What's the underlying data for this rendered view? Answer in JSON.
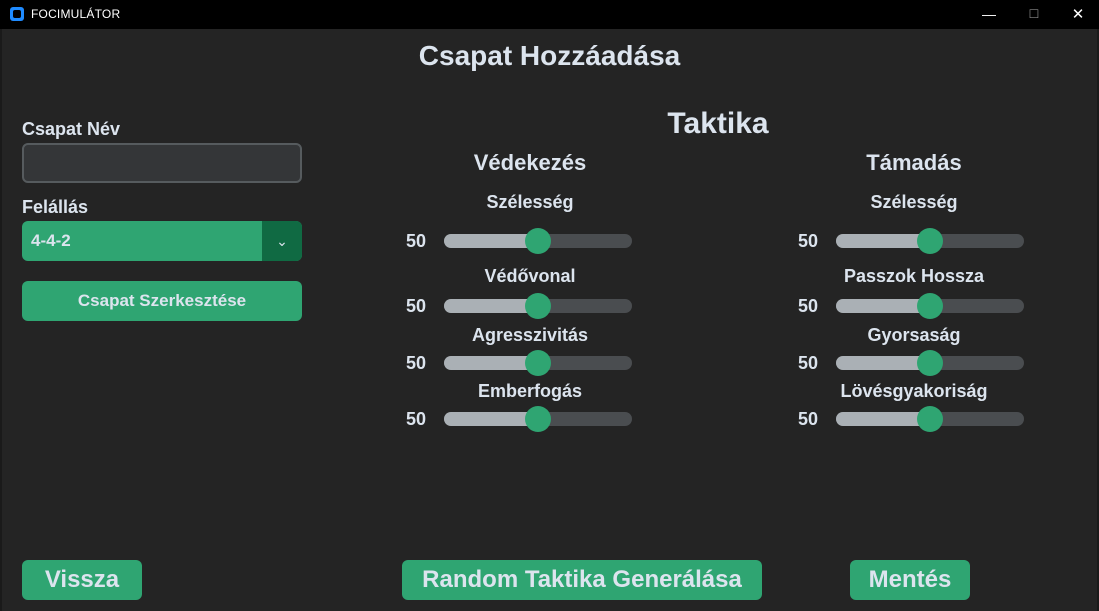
{
  "window": {
    "title": "FOCIMULÁTOR",
    "minimize_glyph": "—",
    "maximize_glyph": "☐",
    "close_glyph": "✕",
    "icon": "app-icon"
  },
  "page": {
    "title": "Csapat Hozzáadása"
  },
  "form": {
    "team_name_label": "Csapat Név",
    "team_name_value": "",
    "formation_label": "Felállás",
    "formation_value": "4-4-2",
    "formation_arrow": "⌄",
    "edit_team_label": "Csapat Szerkesztése"
  },
  "tactics": {
    "title": "Taktika",
    "defense": {
      "title": "Védekezés",
      "sliders": [
        {
          "label": "Szélesség",
          "value": "50",
          "fraction": 0.5
        },
        {
          "label": "Védővonal",
          "value": "50",
          "fraction": 0.5
        },
        {
          "label": "Agresszivitás",
          "value": "50",
          "fraction": 0.5
        },
        {
          "label": "Emberfogás",
          "value": "50",
          "fraction": 0.5
        }
      ]
    },
    "attack": {
      "title": "Támadás",
      "sliders": [
        {
          "label": "Szélesség",
          "value": "50",
          "fraction": 0.5
        },
        {
          "label": "Passzok Hossza",
          "value": "50",
          "fraction": 0.5
        },
        {
          "label": "Gyorsaság",
          "value": "50",
          "fraction": 0.5
        },
        {
          "label": "Lövésgyakoriság",
          "value": "50",
          "fraction": 0.5
        }
      ]
    }
  },
  "footer": {
    "back_label": "Vissza",
    "random_label": "Random Taktika Generálása",
    "save_label": "Mentés"
  },
  "colors": {
    "accent": "#2fa572",
    "accent_dark": "#106a43",
    "background": "#242424",
    "text": "#dce4ee"
  }
}
